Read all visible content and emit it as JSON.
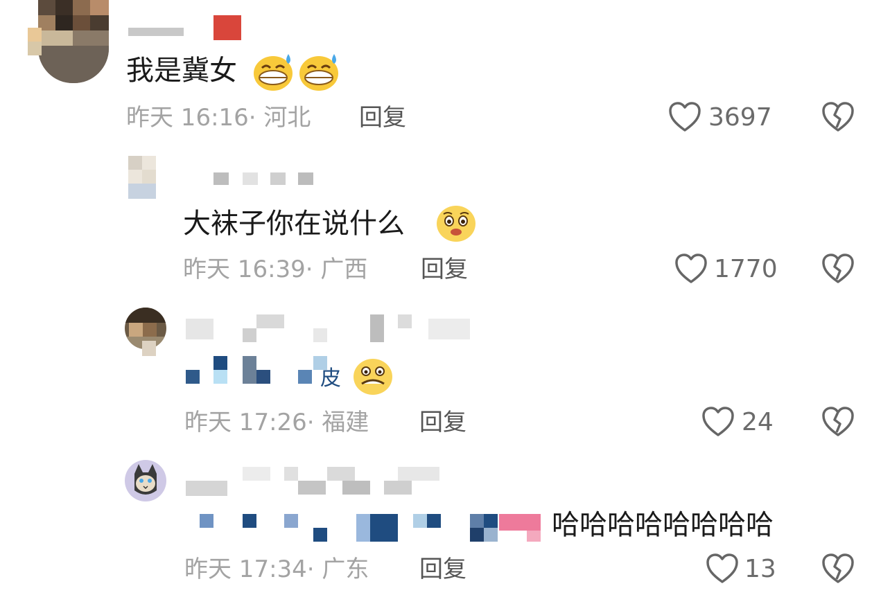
{
  "comments": [
    {
      "text": "我是冀女",
      "time": "昨天 16:16",
      "location": "· 河北",
      "reply_label": "回复",
      "likes": "3697"
    },
    {
      "text": "大袜子你在说什么",
      "time": "昨天 16:39",
      "location": "· 广西",
      "reply_label": "回复",
      "likes": "1770"
    },
    {
      "text": "皮",
      "time": "昨天 17:26",
      "location": "· 福建",
      "reply_label": "回复",
      "likes": "24"
    },
    {
      "text": "哈哈哈哈哈哈哈哈",
      "time": "昨天 17:34",
      "location": "· 广东",
      "reply_label": "回复",
      "likes": "13"
    }
  ],
  "icons": {
    "like": "heart-outline-icon",
    "dislike": "broken-heart-icon",
    "emoji_sweat": "grinning-sweat-emoji",
    "emoji_pleading": "pleading-face-emoji",
    "emoji_grimace": "grimacing-emoji"
  },
  "colors": {
    "text": "#1a1a1a",
    "meta": "#a3a3a3",
    "reply": "#555555",
    "count": "#6b6b6b",
    "icon": "#666666"
  }
}
